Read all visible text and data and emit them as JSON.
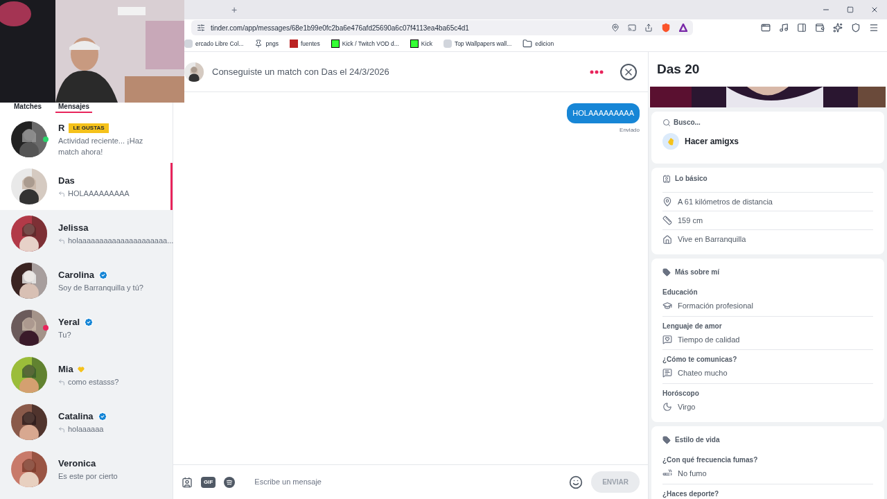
{
  "browser": {
    "new_tab": "+",
    "url": "tinder.com/app/messages/68e1b99e0fc2ba6e476afd25690a6c07f4113ea4ba65c4d1",
    "bookmarks": [
      {
        "label": "ercado Libre Col...",
        "kind": "page"
      },
      {
        "label": "pngs",
        "kind": "pin"
      },
      {
        "label": "fuentes",
        "kind": "red"
      },
      {
        "label": "Kick / Twitch VOD d...",
        "kind": "green"
      },
      {
        "label": "Kick",
        "kind": "green"
      },
      {
        "label": "Top Wallpapers wall...",
        "kind": "page"
      },
      {
        "label": "edicion",
        "kind": "folder"
      }
    ]
  },
  "sidebar": {
    "tabs": [
      {
        "label": "Matches",
        "selected": false
      },
      {
        "label": "Mensajes",
        "selected": true
      }
    ],
    "conversations": [
      {
        "name": "R",
        "tag": "LE GUSTAS",
        "preview": "Actividad reciente... ¡Haz match ahora!",
        "replied": false,
        "verified": false,
        "heart": false,
        "selected": false,
        "kind": "like",
        "color": "#2bd46b"
      },
      {
        "name": "Das",
        "preview": "HOLAAAAAAAAA",
        "replied": true,
        "verified": false,
        "heart": false,
        "selected": true,
        "kind": "match"
      },
      {
        "name": "Jelissa",
        "preview": "holaaaaaaaaaaaaaaaaaaaaa...",
        "replied": true,
        "verified": false,
        "heart": false,
        "selected": false,
        "kind": "match"
      },
      {
        "name": "Carolina",
        "preview": "Soy de Barranquilla y tú?",
        "replied": false,
        "verified": true,
        "heart": false,
        "selected": false,
        "kind": "match"
      },
      {
        "name": "Yeral",
        "preview": "Tu?",
        "replied": false,
        "verified": true,
        "heart": false,
        "selected": false,
        "kind": "match",
        "color": "#e8245b"
      },
      {
        "name": "Mia",
        "preview": "como estasss?",
        "replied": true,
        "verified": false,
        "heart": true,
        "selected": false,
        "kind": "match"
      },
      {
        "name": "Catalina",
        "preview": "holaaaaaa",
        "replied": true,
        "verified": true,
        "heart": false,
        "selected": false,
        "kind": "match"
      },
      {
        "name": "Veronica",
        "preview": "Es este por cierto",
        "replied": false,
        "verified": false,
        "heart": false,
        "selected": false,
        "kind": "match"
      }
    ]
  },
  "chat": {
    "header": "Conseguiste un match con Das el 24/3/2026",
    "messages": [
      {
        "text": "HOLAAAAAAAAA",
        "status": "Enviado"
      }
    ],
    "composer": {
      "gif": "GIF",
      "placeholder": "Escribe un mensaje",
      "send": "ENVIAR",
      "send_disabled": true
    }
  },
  "profile": {
    "name": "Das 20",
    "looking": {
      "label": "Busco...",
      "value": "Hacer amigxs"
    },
    "basics": {
      "title": "Lo básico",
      "rows": [
        {
          "kind": "location",
          "text": "A 61 kilómetros de distancia"
        },
        {
          "kind": "height",
          "text": "159 cm"
        },
        {
          "kind": "home",
          "text": "Vive en Barranquilla"
        }
      ]
    },
    "sections": [
      {
        "title": "Más sobre mí",
        "rows": [
          {
            "label": "Educación",
            "kind": "education",
            "text": "Formación profesional"
          },
          {
            "label": "Lenguaje de amor",
            "kind": "love",
            "text": "Tiempo de calidad"
          },
          {
            "label": "¿Cómo te comunicas?",
            "kind": "chat",
            "text": "Chateo mucho"
          },
          {
            "label": "Horóscopo",
            "kind": "moon",
            "text": "Virgo"
          }
        ]
      },
      {
        "title": "Estilo de vida",
        "rows": [
          {
            "label": "¿Con qué frecuencia fumas?",
            "kind": "smoke",
            "text": "No fumo"
          },
          {
            "label": "¿Haces deporte?"
          }
        ]
      }
    ]
  }
}
